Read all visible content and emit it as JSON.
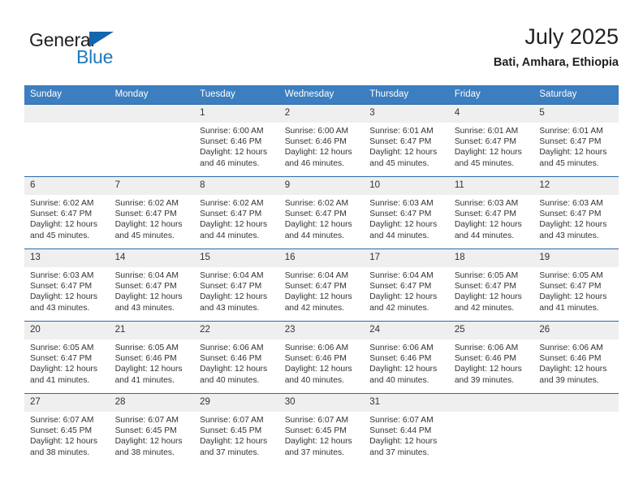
{
  "brand": {
    "name_part1": "General",
    "name_part2": "Blue"
  },
  "header": {
    "title": "July 2025",
    "subtitle": "Bati, Amhara, Ethiopia"
  },
  "colors": {
    "header_bg": "#3c7ebf",
    "row_divider": "#2b6cab",
    "daynum_bg": "#efefef",
    "brand_blue": "#1c7ac0",
    "brand_triangle": "#1566ad",
    "text": "#333333"
  },
  "weekday_headers": [
    "Sunday",
    "Monday",
    "Tuesday",
    "Wednesday",
    "Thursday",
    "Friday",
    "Saturday"
  ],
  "weeks": [
    [
      {
        "day": "",
        "sunrise": "",
        "sunset": "",
        "daylight_line1": "",
        "daylight_line2": ""
      },
      {
        "day": "",
        "sunrise": "",
        "sunset": "",
        "daylight_line1": "",
        "daylight_line2": ""
      },
      {
        "day": "1",
        "sunrise": "Sunrise: 6:00 AM",
        "sunset": "Sunset: 6:46 PM",
        "daylight_line1": "Daylight: 12 hours",
        "daylight_line2": "and 46 minutes."
      },
      {
        "day": "2",
        "sunrise": "Sunrise: 6:00 AM",
        "sunset": "Sunset: 6:46 PM",
        "daylight_line1": "Daylight: 12 hours",
        "daylight_line2": "and 46 minutes."
      },
      {
        "day": "3",
        "sunrise": "Sunrise: 6:01 AM",
        "sunset": "Sunset: 6:47 PM",
        "daylight_line1": "Daylight: 12 hours",
        "daylight_line2": "and 45 minutes."
      },
      {
        "day": "4",
        "sunrise": "Sunrise: 6:01 AM",
        "sunset": "Sunset: 6:47 PM",
        "daylight_line1": "Daylight: 12 hours",
        "daylight_line2": "and 45 minutes."
      },
      {
        "day": "5",
        "sunrise": "Sunrise: 6:01 AM",
        "sunset": "Sunset: 6:47 PM",
        "daylight_line1": "Daylight: 12 hours",
        "daylight_line2": "and 45 minutes."
      }
    ],
    [
      {
        "day": "6",
        "sunrise": "Sunrise: 6:02 AM",
        "sunset": "Sunset: 6:47 PM",
        "daylight_line1": "Daylight: 12 hours",
        "daylight_line2": "and 45 minutes."
      },
      {
        "day": "7",
        "sunrise": "Sunrise: 6:02 AM",
        "sunset": "Sunset: 6:47 PM",
        "daylight_line1": "Daylight: 12 hours",
        "daylight_line2": "and 45 minutes."
      },
      {
        "day": "8",
        "sunrise": "Sunrise: 6:02 AM",
        "sunset": "Sunset: 6:47 PM",
        "daylight_line1": "Daylight: 12 hours",
        "daylight_line2": "and 44 minutes."
      },
      {
        "day": "9",
        "sunrise": "Sunrise: 6:02 AM",
        "sunset": "Sunset: 6:47 PM",
        "daylight_line1": "Daylight: 12 hours",
        "daylight_line2": "and 44 minutes."
      },
      {
        "day": "10",
        "sunrise": "Sunrise: 6:03 AM",
        "sunset": "Sunset: 6:47 PM",
        "daylight_line1": "Daylight: 12 hours",
        "daylight_line2": "and 44 minutes."
      },
      {
        "day": "11",
        "sunrise": "Sunrise: 6:03 AM",
        "sunset": "Sunset: 6:47 PM",
        "daylight_line1": "Daylight: 12 hours",
        "daylight_line2": "and 44 minutes."
      },
      {
        "day": "12",
        "sunrise": "Sunrise: 6:03 AM",
        "sunset": "Sunset: 6:47 PM",
        "daylight_line1": "Daylight: 12 hours",
        "daylight_line2": "and 43 minutes."
      }
    ],
    [
      {
        "day": "13",
        "sunrise": "Sunrise: 6:03 AM",
        "sunset": "Sunset: 6:47 PM",
        "daylight_line1": "Daylight: 12 hours",
        "daylight_line2": "and 43 minutes."
      },
      {
        "day": "14",
        "sunrise": "Sunrise: 6:04 AM",
        "sunset": "Sunset: 6:47 PM",
        "daylight_line1": "Daylight: 12 hours",
        "daylight_line2": "and 43 minutes."
      },
      {
        "day": "15",
        "sunrise": "Sunrise: 6:04 AM",
        "sunset": "Sunset: 6:47 PM",
        "daylight_line1": "Daylight: 12 hours",
        "daylight_line2": "and 43 minutes."
      },
      {
        "day": "16",
        "sunrise": "Sunrise: 6:04 AM",
        "sunset": "Sunset: 6:47 PM",
        "daylight_line1": "Daylight: 12 hours",
        "daylight_line2": "and 42 minutes."
      },
      {
        "day": "17",
        "sunrise": "Sunrise: 6:04 AM",
        "sunset": "Sunset: 6:47 PM",
        "daylight_line1": "Daylight: 12 hours",
        "daylight_line2": "and 42 minutes."
      },
      {
        "day": "18",
        "sunrise": "Sunrise: 6:05 AM",
        "sunset": "Sunset: 6:47 PM",
        "daylight_line1": "Daylight: 12 hours",
        "daylight_line2": "and 42 minutes."
      },
      {
        "day": "19",
        "sunrise": "Sunrise: 6:05 AM",
        "sunset": "Sunset: 6:47 PM",
        "daylight_line1": "Daylight: 12 hours",
        "daylight_line2": "and 41 minutes."
      }
    ],
    [
      {
        "day": "20",
        "sunrise": "Sunrise: 6:05 AM",
        "sunset": "Sunset: 6:47 PM",
        "daylight_line1": "Daylight: 12 hours",
        "daylight_line2": "and 41 minutes."
      },
      {
        "day": "21",
        "sunrise": "Sunrise: 6:05 AM",
        "sunset": "Sunset: 6:46 PM",
        "daylight_line1": "Daylight: 12 hours",
        "daylight_line2": "and 41 minutes."
      },
      {
        "day": "22",
        "sunrise": "Sunrise: 6:06 AM",
        "sunset": "Sunset: 6:46 PM",
        "daylight_line1": "Daylight: 12 hours",
        "daylight_line2": "and 40 minutes."
      },
      {
        "day": "23",
        "sunrise": "Sunrise: 6:06 AM",
        "sunset": "Sunset: 6:46 PM",
        "daylight_line1": "Daylight: 12 hours",
        "daylight_line2": "and 40 minutes."
      },
      {
        "day": "24",
        "sunrise": "Sunrise: 6:06 AM",
        "sunset": "Sunset: 6:46 PM",
        "daylight_line1": "Daylight: 12 hours",
        "daylight_line2": "and 40 minutes."
      },
      {
        "day": "25",
        "sunrise": "Sunrise: 6:06 AM",
        "sunset": "Sunset: 6:46 PM",
        "daylight_line1": "Daylight: 12 hours",
        "daylight_line2": "and 39 minutes."
      },
      {
        "day": "26",
        "sunrise": "Sunrise: 6:06 AM",
        "sunset": "Sunset: 6:46 PM",
        "daylight_line1": "Daylight: 12 hours",
        "daylight_line2": "and 39 minutes."
      }
    ],
    [
      {
        "day": "27",
        "sunrise": "Sunrise: 6:07 AM",
        "sunset": "Sunset: 6:45 PM",
        "daylight_line1": "Daylight: 12 hours",
        "daylight_line2": "and 38 minutes."
      },
      {
        "day": "28",
        "sunrise": "Sunrise: 6:07 AM",
        "sunset": "Sunset: 6:45 PM",
        "daylight_line1": "Daylight: 12 hours",
        "daylight_line2": "and 38 minutes."
      },
      {
        "day": "29",
        "sunrise": "Sunrise: 6:07 AM",
        "sunset": "Sunset: 6:45 PM",
        "daylight_line1": "Daylight: 12 hours",
        "daylight_line2": "and 37 minutes."
      },
      {
        "day": "30",
        "sunrise": "Sunrise: 6:07 AM",
        "sunset": "Sunset: 6:45 PM",
        "daylight_line1": "Daylight: 12 hours",
        "daylight_line2": "and 37 minutes."
      },
      {
        "day": "31",
        "sunrise": "Sunrise: 6:07 AM",
        "sunset": "Sunset: 6:44 PM",
        "daylight_line1": "Daylight: 12 hours",
        "daylight_line2": "and 37 minutes."
      },
      {
        "day": "",
        "sunrise": "",
        "sunset": "",
        "daylight_line1": "",
        "daylight_line2": ""
      },
      {
        "day": "",
        "sunrise": "",
        "sunset": "",
        "daylight_line1": "",
        "daylight_line2": ""
      }
    ]
  ]
}
